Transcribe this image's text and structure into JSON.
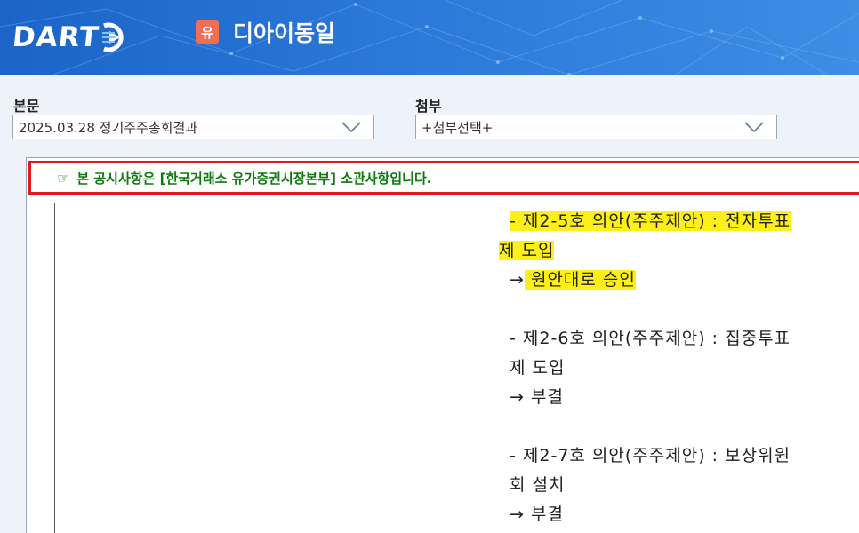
{
  "header": {
    "logo_text": "DART",
    "company_badge": "유",
    "company_name": "디아이동일"
  },
  "report_select": {
    "label": "본문",
    "value": "2025.03.28  정기주주총회결과"
  },
  "attachment_select": {
    "label": "첨부",
    "value": "+첨부선택+"
  },
  "notice": {
    "icon": "☞",
    "text": "본 공시사항은 [한국거래소 유가증권시장본부] 소관사항입니다."
  },
  "content": {
    "item5_line1": "  - 제2-5호 의안(주주제안) : 전자투표",
    "item5_line2": "제 도입 ",
    "item5_arrow": "→",
    "item5_result": " 원안대로 승인 ",
    "item6_line1": "  - 제2-6호 의안(주주제안) : 집중투표",
    "item6_line2": "제 도입",
    "item6_result": "→ 부결",
    "item7_line1": "  - 제2-7호 의안(주주제안) : 보상위원",
    "item7_line2": "회 설치",
    "item7_result": "→ 부결"
  },
  "colors": {
    "header_blue": "#2a78d8",
    "notice_border": "#e01919",
    "notice_text": "#0d7a0d",
    "highlight": "#ffef18",
    "badge": "#f06f52"
  }
}
